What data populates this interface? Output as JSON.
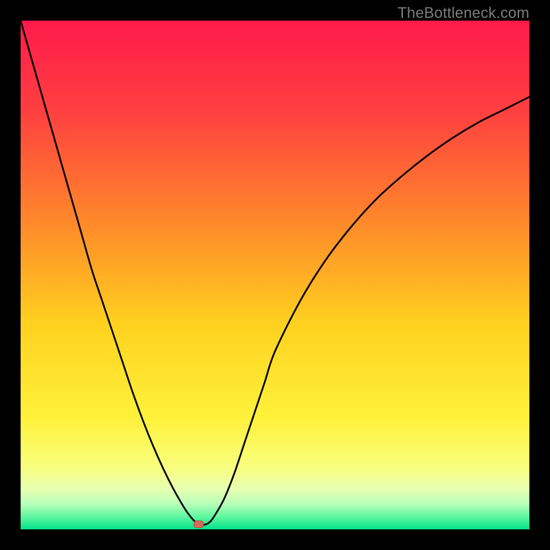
{
  "watermark": "TheBottleneck.com",
  "colors": {
    "background": "#000000",
    "curve": "#000000",
    "marker_fill": "#d36a5e",
    "marker_stroke": "#b34d41",
    "gradient_stops": [
      {
        "offset": 0.0,
        "color": "#ff1a4b"
      },
      {
        "offset": 0.18,
        "color": "#ff4040"
      },
      {
        "offset": 0.4,
        "color": "#ff8a2a"
      },
      {
        "offset": 0.6,
        "color": "#ffd21f"
      },
      {
        "offset": 0.78,
        "color": "#fff13a"
      },
      {
        "offset": 0.88,
        "color": "#f8ff80"
      },
      {
        "offset": 0.92,
        "color": "#e8ffb0"
      },
      {
        "offset": 0.95,
        "color": "#b8ffb8"
      },
      {
        "offset": 0.975,
        "color": "#60f7a0"
      },
      {
        "offset": 1.0,
        "color": "#00e38a"
      }
    ]
  },
  "chart_data": {
    "type": "line",
    "title": "",
    "xlabel": "",
    "ylabel": "",
    "xlim": [
      0,
      100
    ],
    "ylim": [
      0,
      100
    ],
    "x": [
      0,
      2,
      4,
      6,
      8,
      10,
      12,
      14,
      16,
      18,
      20,
      22,
      24,
      26,
      28,
      30,
      32,
      33,
      34,
      35,
      36,
      37,
      38,
      40,
      42,
      44,
      46,
      48,
      50,
      55,
      60,
      65,
      70,
      75,
      80,
      85,
      90,
      95,
      100
    ],
    "series": [
      {
        "name": "bottleneck-curve",
        "values": [
          100,
          93,
          86,
          79,
          72,
          65,
          58,
          51,
          45,
          39,
          33,
          27,
          21.5,
          16.5,
          12,
          8,
          4.5,
          3,
          1.8,
          1,
          0.9,
          1.3,
          2.5,
          6,
          11,
          17,
          23,
          29,
          35,
          45,
          53,
          59.5,
          65,
          69.5,
          73.5,
          77,
          80,
          82.5,
          85
        ]
      }
    ],
    "marker": {
      "x": 35,
      "y": 1
    }
  }
}
